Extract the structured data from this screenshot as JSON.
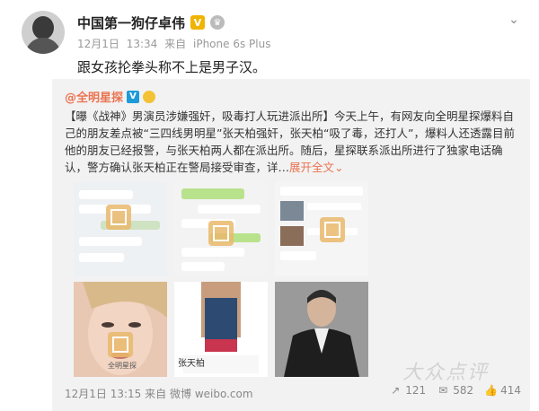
{
  "author": {
    "name": "中国第一狗仔卓伟",
    "verified_badge": "V",
    "date": "12月1日",
    "time": "13:34",
    "source_prefix": "来自",
    "device": "iPhone 6s Plus"
  },
  "post_text": "跟女孩抡拳头称不上是男子汉。",
  "repost": {
    "author_name": "@全明星探",
    "verified_badge": "V",
    "text_segments": {
      "lead": "【曝《战神》男演员涉嫌强奸，吸毒打人玩进派出所】今天上午，有网友向全明星探爆料自己的朋友差点被“三四线男明星”",
      "name": "张天柏",
      "mid1": "强奸，",
      "name2": "张天柏",
      "mid2": "“吸了毒，还打人”，爆料人还透露目前他的朋友已经报警，与",
      "name3": "张天柏",
      "tail": "两人都在派出所。随后，星探联系派出所进行了独家电话确认，警方确认",
      "name4": "张天柏",
      "tail2": "正在警局接受审查，详…",
      "more": "展开全文",
      "more_icon": "chevron-down"
    },
    "thumb_captions": {
      "thumb8": "张天柏",
      "thumb7_logo": "全明星探"
    },
    "footer": {
      "date": "12月1日",
      "time": "13:15",
      "source_prefix": "来自",
      "source": "微博 weibo.com"
    },
    "actions": {
      "repost_count": "121",
      "comment_count": "582",
      "like_count": "414"
    }
  },
  "watermark_text": "大众点评",
  "colors": {
    "link": "#eb7350",
    "muted": "#999999",
    "repost_bg": "#f2f2f2",
    "badge_gold": "#f0b400",
    "badge_blue": "#1d9bd8"
  }
}
